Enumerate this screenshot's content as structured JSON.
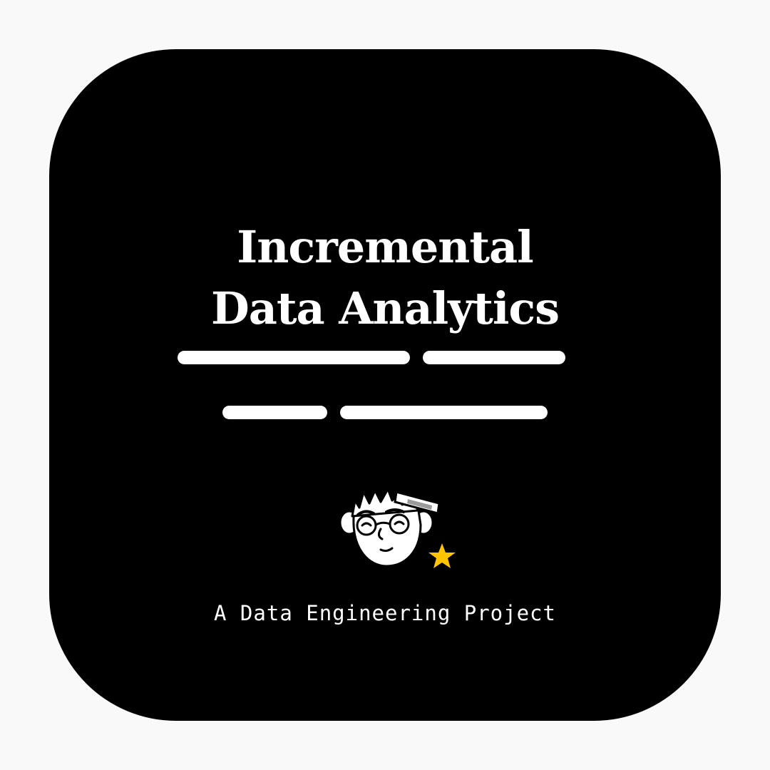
{
  "card": {
    "title_line1": "Incremental",
    "title_line2": "Data Analytics",
    "subtitle": "A Data Engineering Project"
  },
  "icons": {
    "mascot": "cartoon-face-with-glasses-icon",
    "star": "star-icon"
  },
  "colors": {
    "page_background": "#f9f9f9",
    "card_background": "#000000",
    "text": "#ffffff",
    "star": "#ffc400"
  }
}
